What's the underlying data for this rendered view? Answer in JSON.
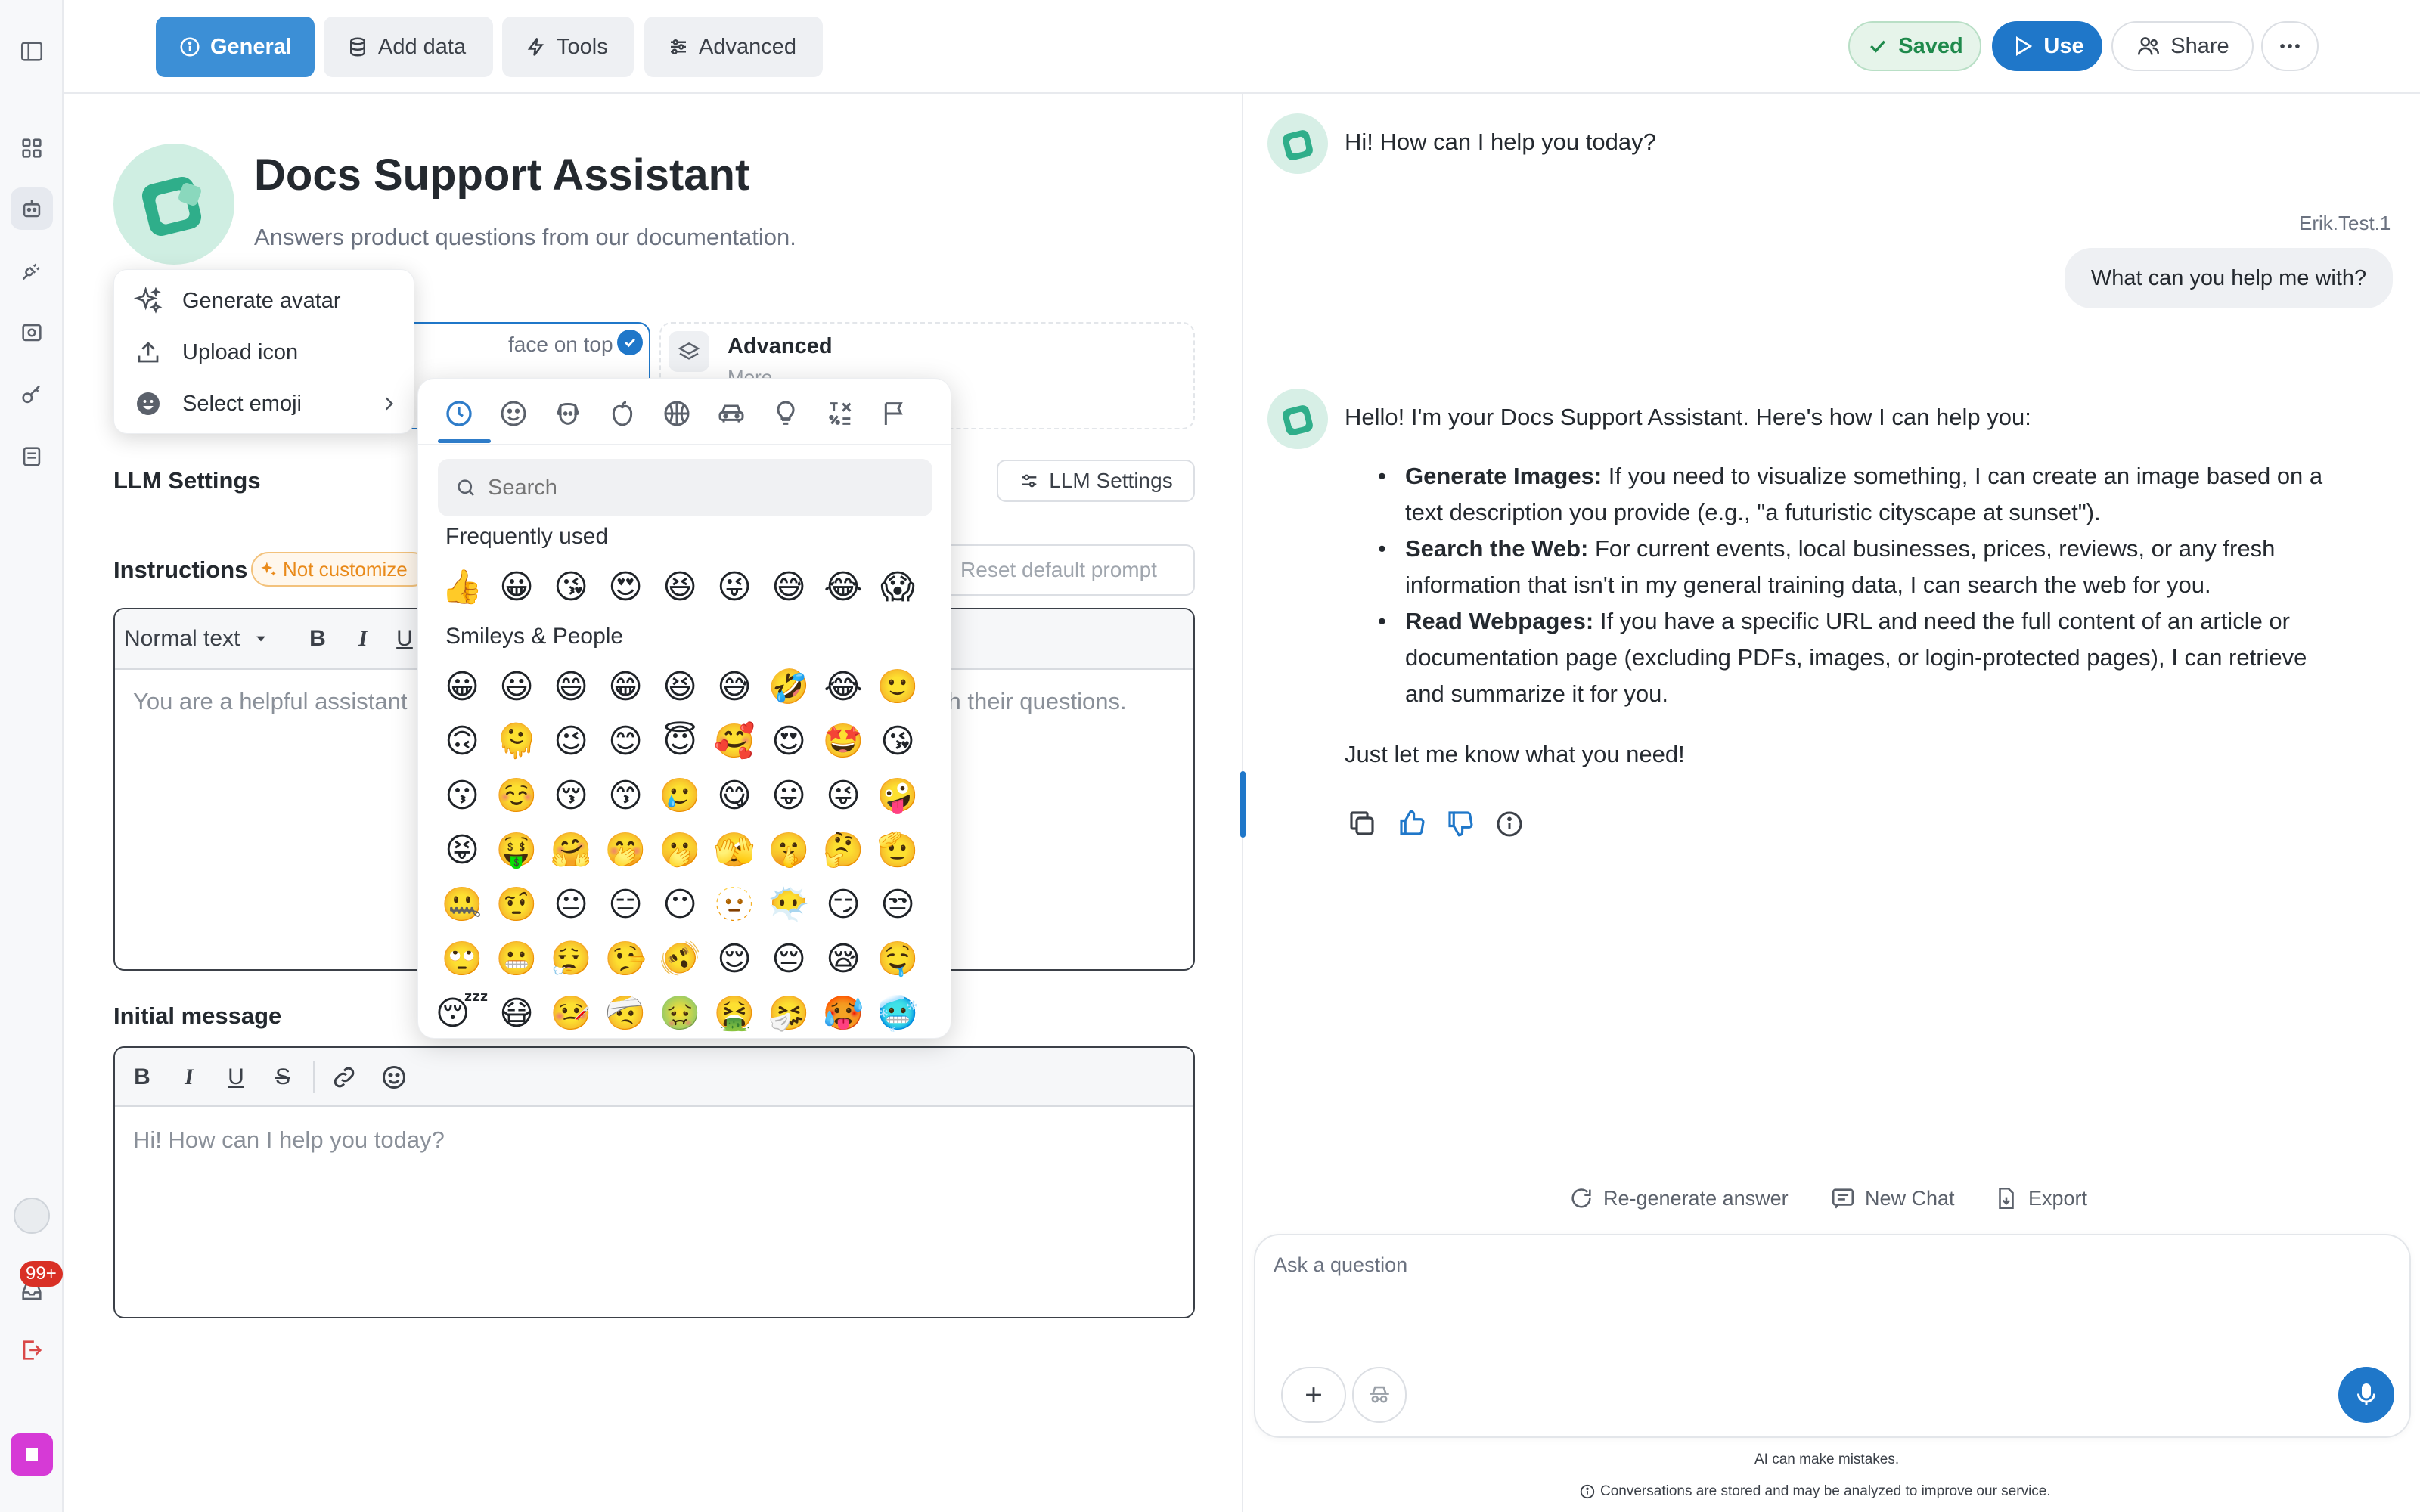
{
  "nav": {
    "badge_count": "99+"
  },
  "topbar": {
    "tabs": [
      {
        "label": "General",
        "icon": "info-circle-icon"
      },
      {
        "label": "Add data",
        "icon": "database-icon"
      },
      {
        "label": "Tools",
        "icon": "lightning-icon"
      },
      {
        "label": "Advanced",
        "icon": "sliders-icon"
      }
    ],
    "saved_label": "Saved",
    "use_label": "Use",
    "share_label": "Share"
  },
  "assistant": {
    "name": "Docs Support Assistant",
    "description": "Answers product questions from our documentation."
  },
  "avatar_menu": {
    "items": [
      {
        "label": "Generate avatar",
        "icon": "sparkles-icon"
      },
      {
        "label": "Upload icon",
        "icon": "upload-icon"
      },
      {
        "label": "Select emoji",
        "icon": "smiley-icon"
      }
    ]
  },
  "mode_cards": {
    "first_partial": "face on top of",
    "advanced_title": "Advanced",
    "advanced_partial": "More"
  },
  "llm_settings": {
    "label": "LLM Settings",
    "button_label": "LLM Settings"
  },
  "instructions": {
    "label": "Instructions",
    "badge": "Not customize",
    "reset_label": "Reset default prompt",
    "format_value": "Normal text",
    "text_left": "You are a helpful assistant",
    "text_right": "ith their questions."
  },
  "initial_message": {
    "label": "Initial message",
    "text": "Hi! How can I help you today?"
  },
  "emoji_picker": {
    "search_placeholder": "Search",
    "frequent_label": "Frequently used",
    "smileys_label": "Smileys & People",
    "frequent": [
      "👍",
      "😀",
      "😘",
      "😍",
      "😆",
      "😜",
      "😅",
      "😂",
      "😱"
    ],
    "smileys": [
      "😀",
      "😃",
      "😄",
      "😁",
      "😆",
      "😅",
      "🤣",
      "😂",
      "🙂",
      "🙃",
      "🫠",
      "😉",
      "😊",
      "😇",
      "🥰",
      "😍",
      "🤩",
      "😘",
      "😗",
      "☺️",
      "😚",
      "😙",
      "🥲",
      "😋",
      "😛",
      "😜",
      "🤪",
      "😝",
      "🤑",
      "🤗",
      "🤭",
      "🫢",
      "🫣",
      "🤫",
      "🤔",
      "🫡",
      "🤐",
      "🤨",
      "😐",
      "😑",
      "😶",
      "🫥",
      "😶‍🌫️",
      "😏",
      "😒",
      "🙄",
      "😬",
      "😮‍💨",
      "🤥",
      "🫨",
      "😌",
      "😔",
      "😪",
      "🤤",
      "😴",
      "😷",
      "🤒",
      "🤕",
      "🤢",
      "🤮",
      "🤧",
      "🥵",
      "🥶"
    ]
  },
  "chat": {
    "greeting": "Hi! How can I help you today?",
    "user_name": "Erik.Test.1",
    "user_message": "What can you help me with?",
    "reply_intro": "Hello! I'm your Docs Support Assistant. Here's how I can help you:",
    "bullets": [
      {
        "title": "Generate Images:",
        "line1": " If you need to visualize something, I can create an image based on a",
        "line2": "text description you provide (e.g., \"a futuristic cityscape at sunset\")."
      },
      {
        "title": "Search the Web:",
        "line1": " For current events, local businesses, prices, reviews, or any fresh",
        "line2": "information that isn't in my general training data, I can search the web for you."
      },
      {
        "title": "Read Webpages:",
        "line1": " If you have a specific URL and need the full content of an article or",
        "line2": "documentation page (excluding PDFs, images, or login-protected pages), I can retrieve",
        "line3": "and summarize it for you."
      }
    ],
    "reply_outro": "Just let me know what you need!",
    "regenerate_label": "Re-generate answer",
    "new_chat_label": "New Chat",
    "export_label": "Export",
    "composer_placeholder": "Ask a question",
    "disclaimer": "AI can make mistakes.",
    "privacy_note": "Conversations are stored and may be analyzed to improve our service."
  },
  "colors": {
    "primary": "#1f77c9",
    "general_tab": "#3c8fd6",
    "saved_green": "#1f8a4c",
    "badge_orange": "#e98a1a",
    "notification_red": "#d93025",
    "avatar_teal": "#2fae8a"
  }
}
